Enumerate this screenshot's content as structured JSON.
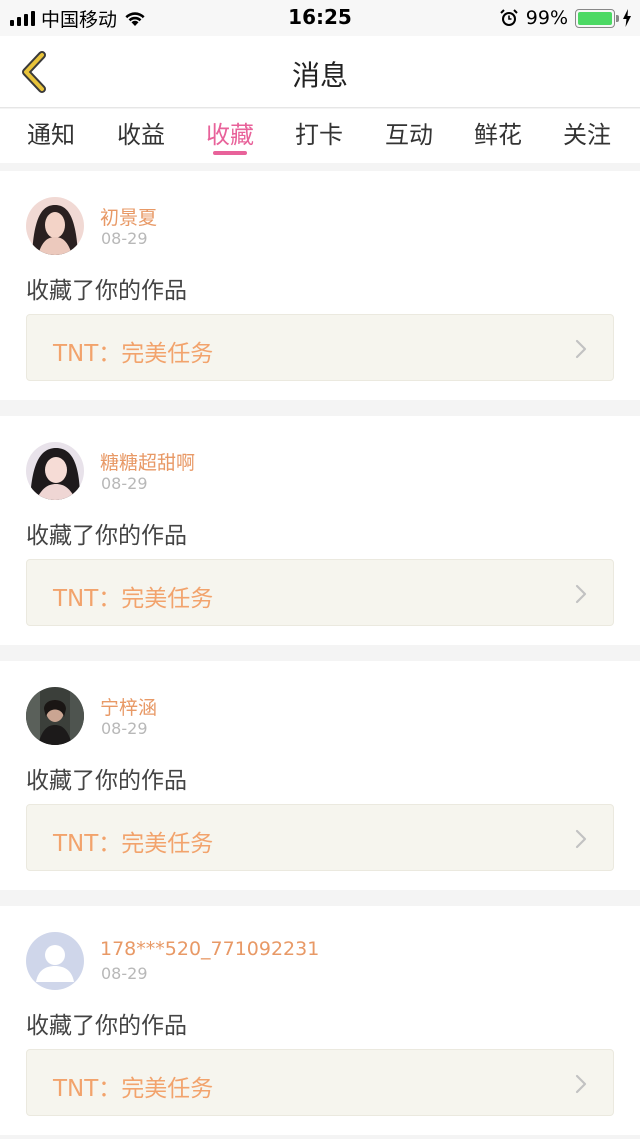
{
  "status_bar": {
    "carrier": "中国移动",
    "time": "16:25",
    "battery_percent": "99%",
    "icons": [
      "signal-icon",
      "wifi-icon",
      "alarm-icon",
      "battery-icon",
      "charging-icon"
    ]
  },
  "nav": {
    "title": "消息",
    "back_icon": "chevron-left-icon"
  },
  "tabs": [
    {
      "label": "通知",
      "active": false
    },
    {
      "label": "收益",
      "active": false
    },
    {
      "label": "收藏",
      "active": true
    },
    {
      "label": "打卡",
      "active": false
    },
    {
      "label": "互动",
      "active": false
    },
    {
      "label": "鲜花",
      "active": false
    },
    {
      "label": "关注",
      "active": false
    }
  ],
  "messages": [
    {
      "username": "初景夏",
      "date": "08-29",
      "action": "收藏了你的作品",
      "work_title": "TNT：完美任务",
      "avatar": "user-photo-avatar"
    },
    {
      "username": "糖糖超甜啊",
      "date": "08-29",
      "action": "收藏了你的作品",
      "work_title": "TNT：完美任务",
      "avatar": "user-photo-avatar"
    },
    {
      "username": "宁梓涵",
      "date": "08-29",
      "action": "收藏了你的作品",
      "work_title": "TNT：完美任务",
      "avatar": "user-photo-avatar"
    },
    {
      "username": "178***520_771092231",
      "date": "08-29",
      "action": "收藏了你的作品",
      "work_title": "TNT：完美任务",
      "avatar": "default-avatar-icon"
    }
  ],
  "colors": {
    "accent_pink": "#e8629a",
    "username_orange": "#e89966",
    "work_title_orange": "#f2a36c",
    "back_arrow_yellow": "#e8c33a",
    "battery_green": "#4cd964"
  }
}
